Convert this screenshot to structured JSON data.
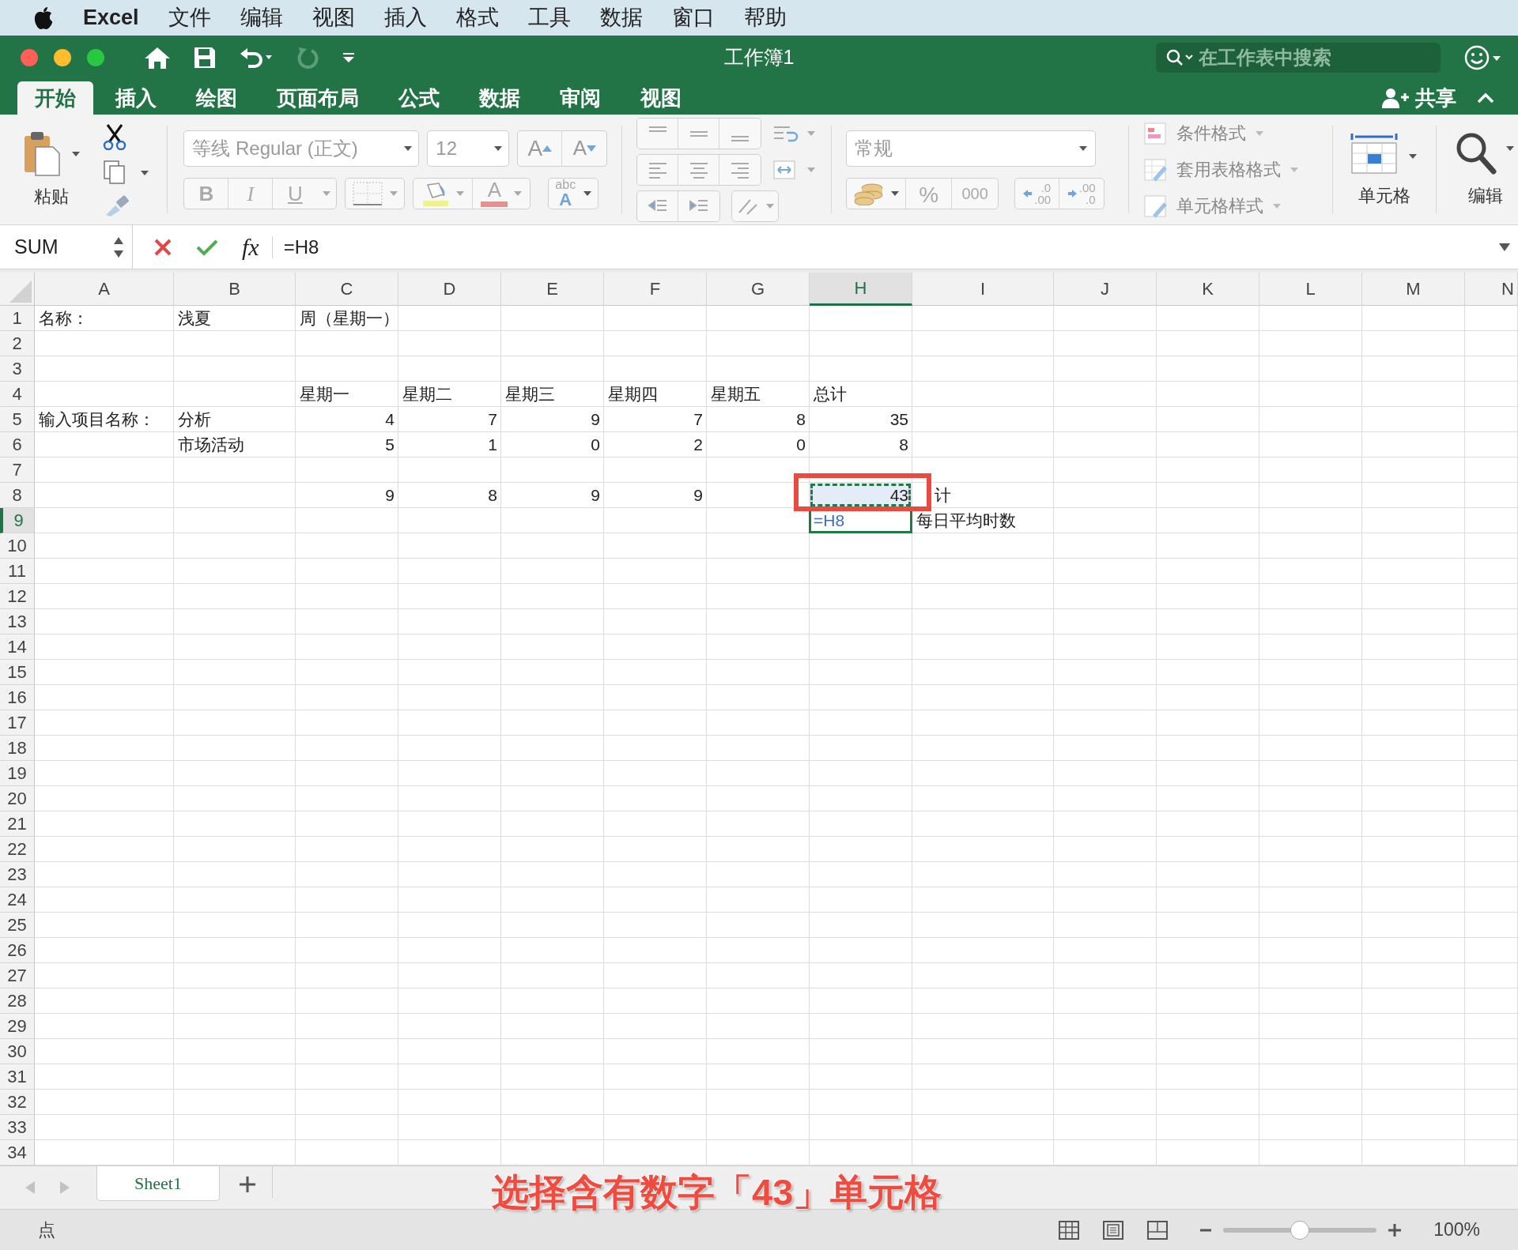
{
  "menu_bar": {
    "app": "Excel",
    "items": [
      "文件",
      "编辑",
      "视图",
      "插入",
      "格式",
      "工具",
      "数据",
      "窗口",
      "帮助"
    ]
  },
  "window": {
    "title": "工作簿1",
    "search_placeholder": "在工作表中搜索",
    "share": "共享"
  },
  "ribbon_tabs": [
    {
      "label": "开始",
      "selected": true
    },
    {
      "label": "插入",
      "selected": false
    },
    {
      "label": "绘图",
      "selected": false
    },
    {
      "label": "页面布局",
      "selected": false
    },
    {
      "label": "公式",
      "selected": false
    },
    {
      "label": "数据",
      "selected": false
    },
    {
      "label": "审阅",
      "selected": false
    },
    {
      "label": "视图",
      "selected": false
    }
  ],
  "ribbon": {
    "paste": "粘贴",
    "font_name": "等线 Regular (正文)",
    "font_size": "12",
    "grow_font": "A",
    "shrink_font": "A",
    "bold": "B",
    "italic": "I",
    "underline": "U",
    "font_color": "A",
    "phonetic": "abc",
    "phonetic_letter": "A",
    "number_format": "常规",
    "percent": "%",
    "comma": "000",
    "increase_decimal": [
      ".0",
      ".00"
    ],
    "decrease_decimal": [
      ".00",
      ".0"
    ],
    "styles": [
      "条件格式",
      "套用表格格式",
      "单元格样式"
    ],
    "cells": "单元格",
    "editing": "编辑"
  },
  "formula_bar": {
    "name_box": "SUM",
    "function_label": "fx",
    "formula": "=H8"
  },
  "columns": [
    {
      "label": "A",
      "selected": false
    },
    {
      "label": "B",
      "selected": false
    },
    {
      "label": "C",
      "selected": false
    },
    {
      "label": "D",
      "selected": false
    },
    {
      "label": "E",
      "selected": false
    },
    {
      "label": "F",
      "selected": false
    },
    {
      "label": "G",
      "selected": false
    },
    {
      "label": "H",
      "selected": true
    },
    {
      "label": "I",
      "selected": false
    },
    {
      "label": "J",
      "selected": false
    },
    {
      "label": "K",
      "selected": false
    },
    {
      "label": "L",
      "selected": false
    },
    {
      "label": "M",
      "selected": false
    },
    {
      "label": "N",
      "selected": false
    }
  ],
  "rows": [
    {
      "number": "1",
      "selected": false,
      "cells": [
        {
          "text": "名称：",
          "kind": "text"
        },
        {
          "text": "浅夏",
          "kind": "text"
        },
        {
          "text": "周（星期一）",
          "kind": "text"
        }
      ]
    },
    {
      "number": "2",
      "selected": false
    },
    {
      "number": "3",
      "selected": false
    },
    {
      "number": "4",
      "selected": false,
      "cells": [
        null,
        null,
        {
          "text": "星期一",
          "kind": "text"
        },
        {
          "text": "星期二",
          "kind": "text"
        },
        {
          "text": "星期三",
          "kind": "text"
        },
        {
          "text": "星期四",
          "kind": "text"
        },
        {
          "text": "星期五",
          "kind": "text"
        },
        {
          "text": "总计",
          "kind": "text"
        }
      ]
    },
    {
      "number": "5",
      "selected": false,
      "cells": [
        {
          "text": "输入项目名称：",
          "kind": "text"
        },
        {
          "text": "分析",
          "kind": "text"
        },
        {
          "text": "4",
          "kind": "number"
        },
        {
          "text": "7",
          "kind": "number"
        },
        {
          "text": "9",
          "kind": "number"
        },
        {
          "text": "7",
          "kind": "number"
        },
        {
          "text": "8",
          "kind": "number"
        },
        {
          "text": "35",
          "kind": "number"
        }
      ]
    },
    {
      "number": "6",
      "selected": false,
      "cells": [
        null,
        {
          "text": "市场活动",
          "kind": "text"
        },
        {
          "text": "5",
          "kind": "number"
        },
        {
          "text": "1",
          "kind": "number"
        },
        {
          "text": "0",
          "kind": "number"
        },
        {
          "text": "2",
          "kind": "number"
        },
        {
          "text": "0",
          "kind": "number"
        },
        {
          "text": "8",
          "kind": "number"
        }
      ]
    },
    {
      "number": "7",
      "selected": false
    },
    {
      "number": "8",
      "selected": false,
      "cells": [
        null,
        null,
        {
          "text": "9",
          "kind": "number"
        },
        {
          "text": "8",
          "kind": "number"
        },
        {
          "text": "9",
          "kind": "number"
        },
        {
          "text": "9",
          "kind": "number"
        },
        null,
        {
          "text": "43",
          "kind": "number",
          "copy_marquee": true
        },
        {
          "text": "计",
          "kind": "partial"
        }
      ]
    },
    {
      "number": "9",
      "selected": true,
      "cells": [
        null,
        null,
        null,
        null,
        null,
        null,
        null,
        {
          "text": "=H8",
          "kind": "formula",
          "editing": true
        },
        {
          "text": "每日平均时数",
          "kind": "text"
        }
      ]
    },
    {
      "number": "10",
      "selected": false
    },
    {
      "number": "11",
      "selected": false
    },
    {
      "number": "12",
      "selected": false
    },
    {
      "number": "13",
      "selected": false
    },
    {
      "number": "14",
      "selected": false
    },
    {
      "number": "15",
      "selected": false
    },
    {
      "number": "16",
      "selected": false
    },
    {
      "number": "17",
      "selected": false
    },
    {
      "number": "18",
      "selected": false
    },
    {
      "number": "19",
      "selected": false
    },
    {
      "number": "20",
      "selected": false
    },
    {
      "number": "21",
      "selected": false
    },
    {
      "number": "22",
      "selected": false
    },
    {
      "number": "23",
      "selected": false
    },
    {
      "number": "24",
      "selected": false
    },
    {
      "number": "25",
      "selected": false
    },
    {
      "number": "26",
      "selected": false
    },
    {
      "number": "27",
      "selected": false
    },
    {
      "number": "28",
      "selected": false
    },
    {
      "number": "29",
      "selected": false
    },
    {
      "number": "30",
      "selected": false
    },
    {
      "number": "31",
      "selected": false
    },
    {
      "number": "32",
      "selected": false
    },
    {
      "number": "33",
      "selected": false
    },
    {
      "number": "34",
      "selected": false
    }
  ],
  "sheet_tabs": [
    {
      "label": "Sheet1",
      "selected": true
    }
  ],
  "annotation": {
    "caption": "选择含有数字「43」单元格"
  },
  "status_bar": {
    "mode": "点",
    "zoom": "100%",
    "zoom_slider": {
      "level": 0.5
    }
  }
}
